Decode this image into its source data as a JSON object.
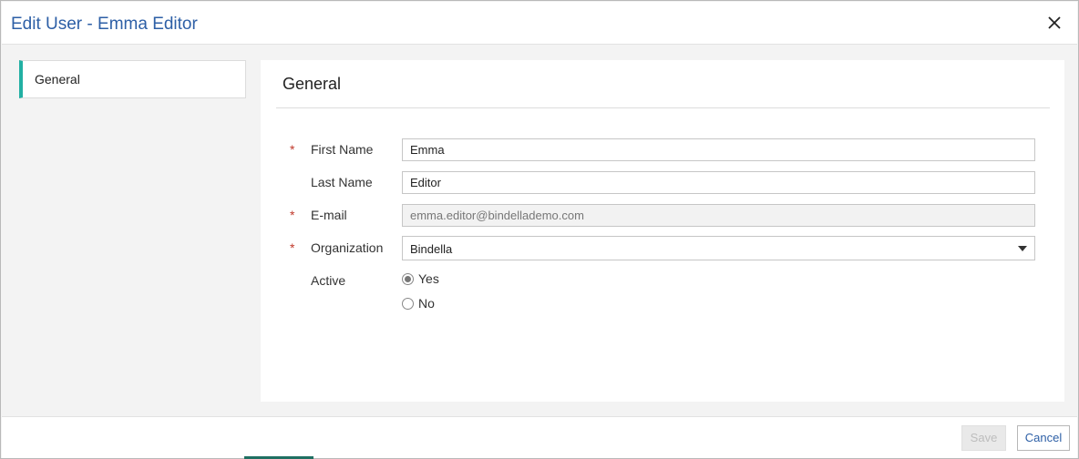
{
  "dialog": {
    "title": "Edit User - Emma Editor",
    "close_icon": "close-icon"
  },
  "nav": {
    "items": [
      {
        "label": "General",
        "selected": true
      }
    ]
  },
  "panel": {
    "title": "General"
  },
  "form": {
    "first_name": {
      "label": "First Name",
      "value": "Emma",
      "required_mark": "*"
    },
    "last_name": {
      "label": "Last Name",
      "value": "Editor"
    },
    "email": {
      "label": "E-mail",
      "value": "emma.editor@bindellademo.com",
      "required_mark": "*"
    },
    "organization": {
      "label": "Organization",
      "value": "Bindella",
      "required_mark": "*"
    },
    "active": {
      "label": "Active",
      "options": [
        {
          "label": "Yes",
          "checked": true
        },
        {
          "label": "No",
          "checked": false
        }
      ]
    }
  },
  "footer": {
    "save_label": "Save",
    "cancel_label": "Cancel"
  },
  "colors": {
    "accent": "#22b0a3",
    "title": "#2d5fa6",
    "required": "#c0392b"
  }
}
